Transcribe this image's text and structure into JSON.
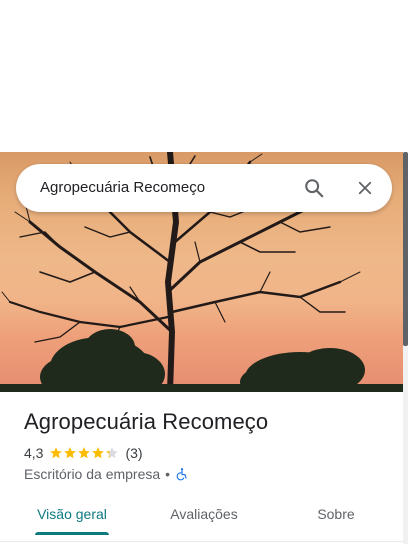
{
  "search": {
    "value": "Agropecuária Recomeço"
  },
  "place": {
    "name": "Agropecuária Recomeço",
    "rating": "4,3",
    "rating_value": 4.3,
    "review_count": "(3)",
    "category": "Escritório da empresa",
    "separator": "•"
  },
  "tabs": [
    {
      "label": "Visão geral",
      "active": true
    },
    {
      "label": "Avaliações",
      "active": false
    },
    {
      "label": "Sobre",
      "active": false
    }
  ],
  "icons": {
    "search": "search-icon",
    "close": "close-icon",
    "star": "star-icon",
    "accessibility": "wheelchair-accessible-icon"
  },
  "colors": {
    "accent": "#0d7a80",
    "star": "#fbbc04",
    "accessibility": "#1a73e8"
  }
}
